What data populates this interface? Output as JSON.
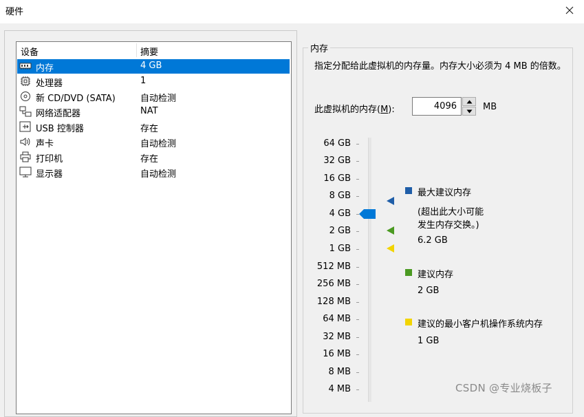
{
  "window": {
    "title": "硬件"
  },
  "device_list": {
    "headers": [
      "设备",
      "摘要"
    ],
    "rows": [
      {
        "name": "内存",
        "summary": "4 GB",
        "icon": "memory-icon",
        "selected": true
      },
      {
        "name": "处理器",
        "summary": "1",
        "icon": "processor-icon"
      },
      {
        "name": "新 CD/DVD (SATA)",
        "summary": "自动检测",
        "icon": "cd-dvd-icon"
      },
      {
        "name": "网络适配器",
        "summary": "NAT",
        "icon": "network-adapter-icon"
      },
      {
        "name": "USB 控制器",
        "summary": "存在",
        "icon": "usb-icon"
      },
      {
        "name": "声卡",
        "summary": "自动检测",
        "icon": "speaker-icon"
      },
      {
        "name": "打印机",
        "summary": "存在",
        "icon": "printer-icon"
      },
      {
        "name": "显示器",
        "summary": "自动检测",
        "icon": "monitor-icon"
      }
    ]
  },
  "memory_panel": {
    "group_title": "内存",
    "description": "指定分配给此虚拟机的内存量。内存大小必须为 4 MB 的倍数。",
    "label_prefix": "此虚拟机的内存(",
    "label_accel": "M",
    "label_suffix": "):",
    "value": "4096",
    "unit": "MB",
    "scale_ticks": [
      "64 GB",
      "32 GB",
      "16 GB",
      "8 GB",
      "4 GB",
      "2 GB",
      "1 GB",
      "512 MB",
      "256 MB",
      "128 MB",
      "64 MB",
      "32 MB",
      "16 MB",
      "8 MB",
      "4 MB"
    ],
    "current_level": "4 GB",
    "legend": {
      "max": {
        "title": "最大建议内存",
        "note_line1": "(超出此大小可能",
        "note_line2": "发生内存交换。)",
        "value": "6.2 GB",
        "color": "#1f5ea8"
      },
      "recommended": {
        "title": "建议内存",
        "value": "2 GB",
        "color": "#4b9a22"
      },
      "min": {
        "title": "建议的最小客户机操作系统内存",
        "value": "1 GB",
        "color": "#f2d400"
      }
    },
    "slider_color": "#0078d7"
  },
  "watermark": "CSDN @专业烧板子"
}
